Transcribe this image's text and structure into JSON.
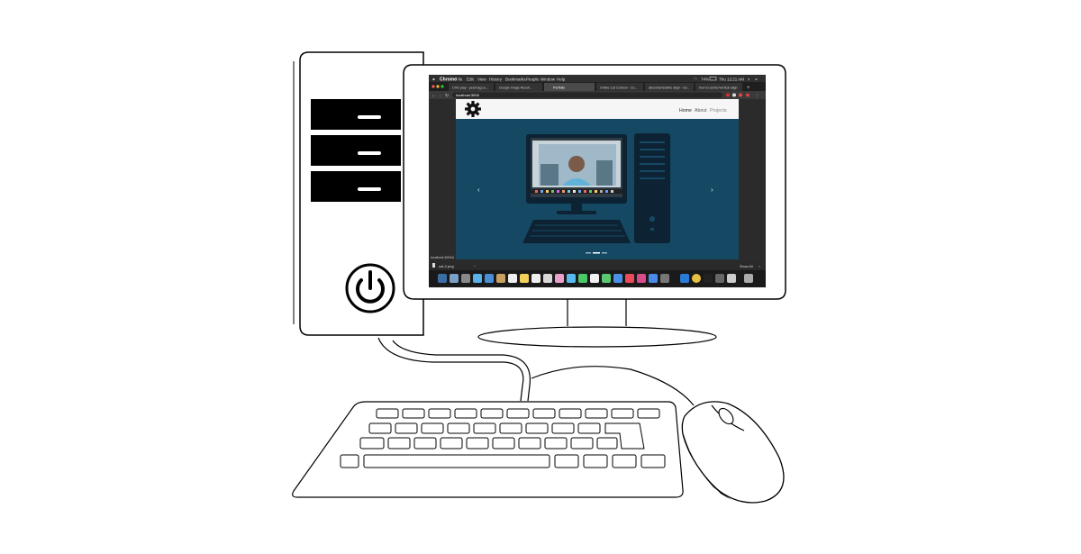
{
  "menubar": {
    "app_name": "Chrome",
    "items": [
      "File",
      "Edit",
      "View",
      "History",
      "Bookmarks",
      "People",
      "Window",
      "Help"
    ],
    "battery": "74%",
    "clock": "Thu 12:21 AM"
  },
  "tabs": [
    {
      "label": "CHG play - yes/no(g.co..."
    },
    {
      "label": "Google Image Result..."
    },
    {
      "label": "Portfolio"
    },
    {
      "label": "Online Cat Cartoon - Co..."
    },
    {
      "label": "absolute/relative align - Go..."
    },
    {
      "label": "how to center/vertical align"
    }
  ],
  "address_bar": {
    "url": "localhost:3000"
  },
  "site": {
    "nav": [
      "Home",
      "About",
      "Projects"
    ]
  },
  "status_url": "localhost:3000/#",
  "download": {
    "filename": "cat-2.png",
    "show_all": "Show All"
  },
  "colors": {
    "hero_bg": "#154863",
    "silhouette": "#0d2333",
    "screen_frame": "#2b2b2b",
    "tab_active": "#ffffff",
    "page_white": "#f6f6f6",
    "outline": "#000000"
  }
}
